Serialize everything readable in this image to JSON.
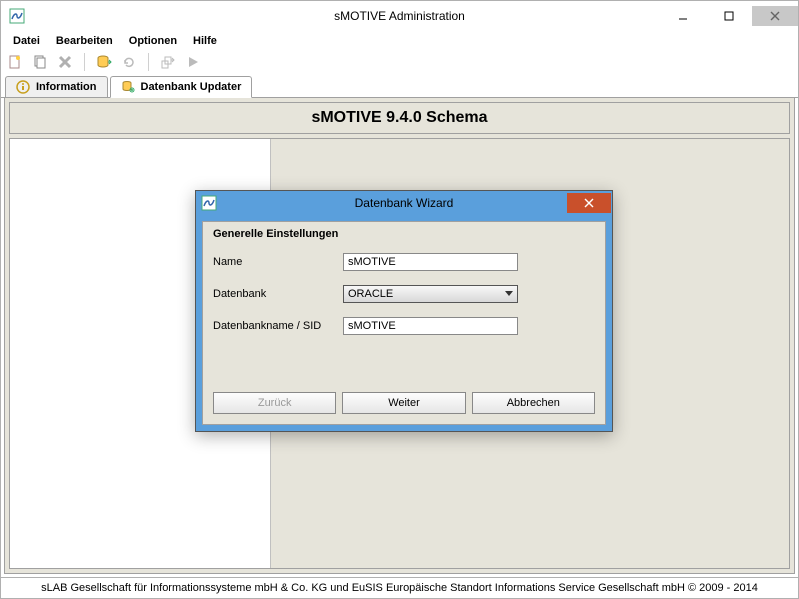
{
  "app": {
    "title": "sMOTIVE Administration"
  },
  "menu": {
    "items": [
      "Datei",
      "Bearbeiten",
      "Optionen",
      "Hilfe"
    ]
  },
  "tabs": [
    {
      "label": "Information",
      "active": false
    },
    {
      "label": "Datenbank Updater",
      "active": true
    }
  ],
  "schema": {
    "header": "sMOTIVE 9.4.0 Schema"
  },
  "dialog": {
    "title": "Datenbank Wizard",
    "section_title": "Generelle Einstellungen",
    "fields": {
      "name_label": "Name",
      "name_value": "sMOTIVE",
      "db_label": "Datenbank",
      "db_value": "ORACLE",
      "sid_label": "Datenbankname / SID",
      "sid_value": "sMOTIVE"
    },
    "buttons": {
      "back": "Zurück",
      "next": "Weiter",
      "cancel": "Abbrechen"
    }
  },
  "status": {
    "text": "sLAB Gesellschaft für Informationssysteme mbH & Co. KG und EuSIS Europäische Standort Informations Service Gesellschaft mbH © 2009 - 2014"
  }
}
